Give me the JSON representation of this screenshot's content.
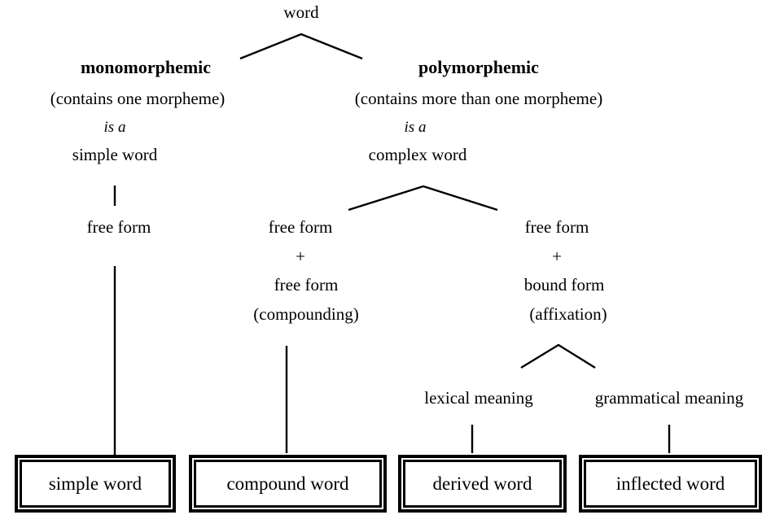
{
  "diagram": {
    "title": "word",
    "root": {
      "label": "word"
    },
    "branches": {
      "monomorphemic": {
        "heading": "monomorphemic",
        "gloss": "(contains one morpheme)",
        "relation": "is a",
        "kind": "simple word",
        "structure": [
          "free form"
        ],
        "terminal": "simple word"
      },
      "polymorphemic": {
        "heading": "polymorphemic",
        "gloss": "(contains more than one morpheme)",
        "relation": "is a",
        "kind": "complex word",
        "children": [
          {
            "structure": [
              "free form",
              "+",
              "free form"
            ],
            "process": "(compounding)",
            "terminal": "compound word"
          },
          {
            "structure": [
              "free form",
              "+",
              "bound form"
            ],
            "process": "(affixation)",
            "meanings": [
              "lexical meaning",
              "grammatical meaning"
            ],
            "terminals": [
              "derived word",
              "inflected word"
            ]
          }
        ]
      }
    },
    "terminals": [
      {
        "label": "simple word"
      },
      {
        "label": "compound word"
      },
      {
        "label": "derived word"
      },
      {
        "label": "inflected word"
      }
    ],
    "meanings": [
      {
        "label": "lexical meaning"
      },
      {
        "label": "grammatical meaning"
      }
    ],
    "colors": {
      "ink": "#000000",
      "paper": "#ffffff"
    }
  }
}
